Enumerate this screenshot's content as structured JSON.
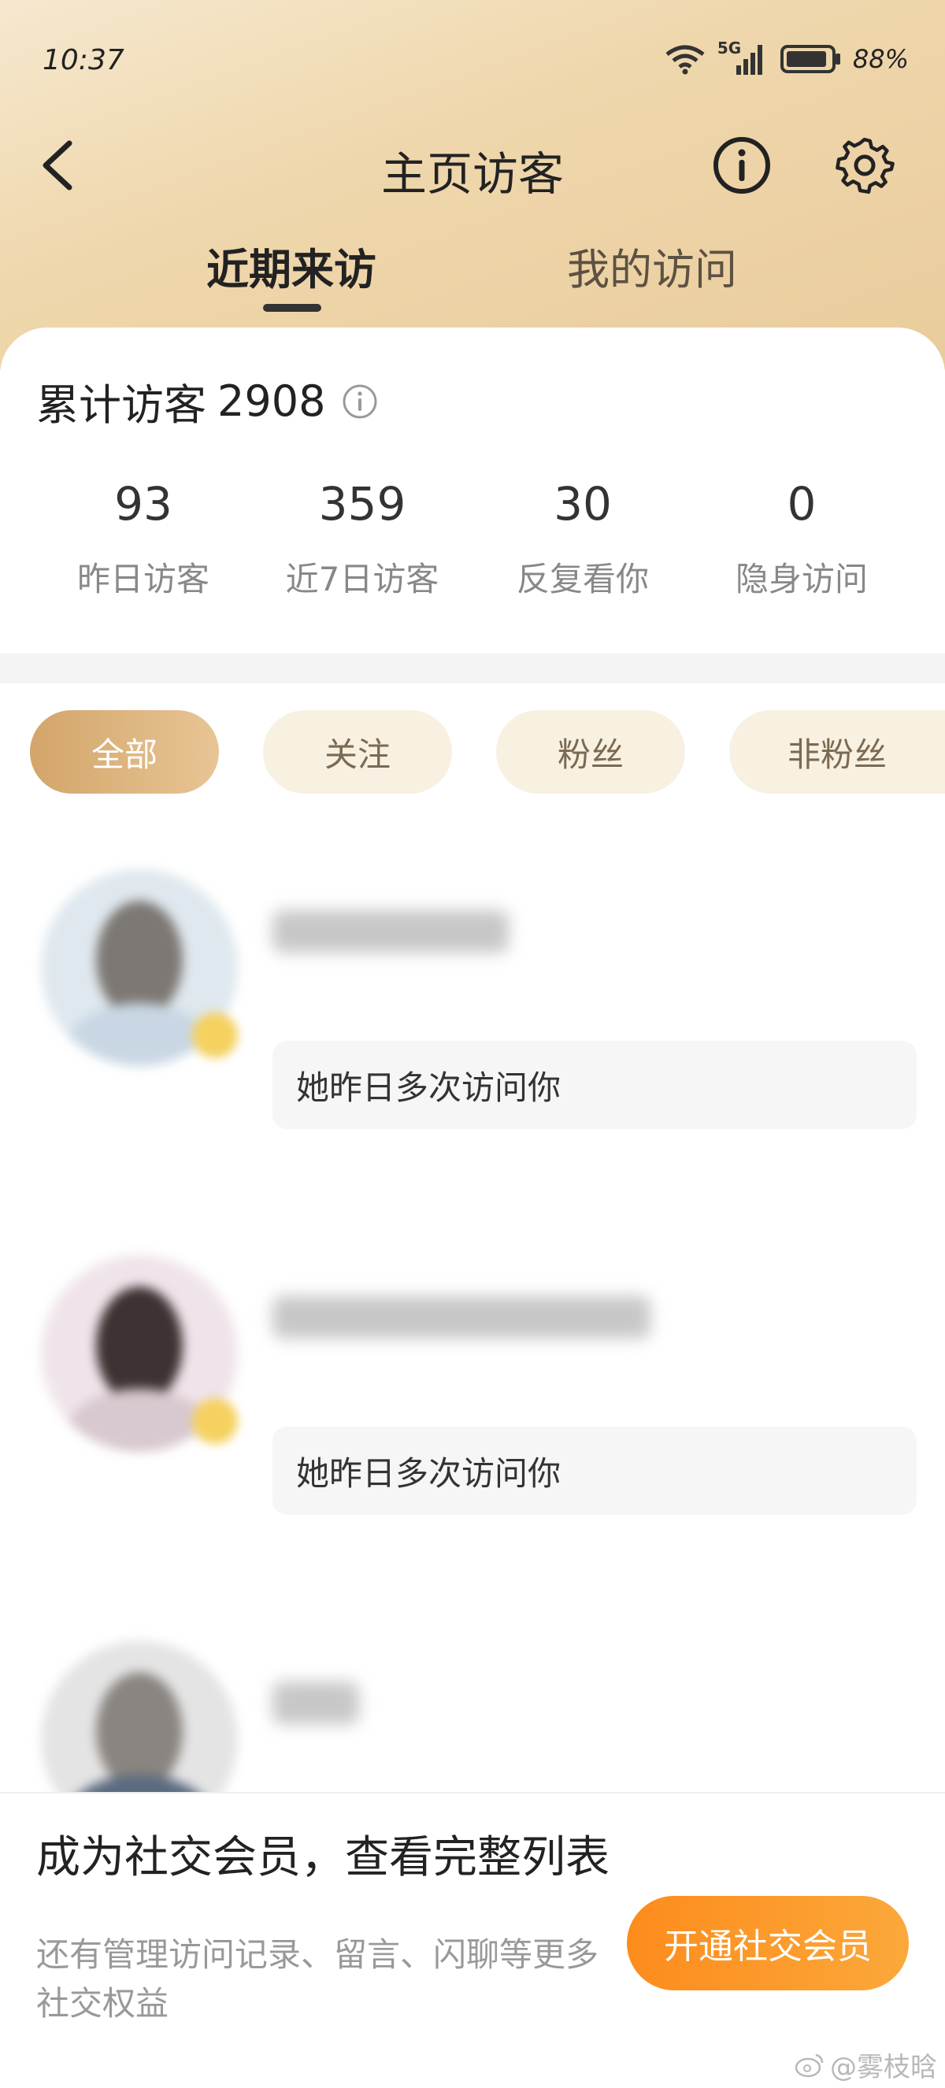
{
  "status_bar": {
    "time": "10:37",
    "network": "5G",
    "battery": "88%"
  },
  "nav": {
    "title": "主页访客"
  },
  "tabs": [
    {
      "label": "近期来访",
      "active": true
    },
    {
      "label": "我的访问",
      "active": false
    }
  ],
  "summary": {
    "total_label": "累计访客",
    "total_value": "2908"
  },
  "stats": [
    {
      "value": "93",
      "label": "昨日访客"
    },
    {
      "value": "359",
      "label": "近7日访客"
    },
    {
      "value": "30",
      "label": "反复看你"
    },
    {
      "value": "0",
      "label": "隐身访问"
    }
  ],
  "filters": [
    {
      "label": "全部",
      "selected": true
    },
    {
      "label": "关注",
      "selected": false
    },
    {
      "label": "粉丝",
      "selected": false
    },
    {
      "label": "非粉丝",
      "selected": false
    }
  ],
  "visitors": [
    {
      "note": "她昨日多次访问你"
    },
    {
      "note": "她昨日多次访问你"
    },
    {
      "note": ""
    }
  ],
  "membership": {
    "title": "成为社交会员，查看完整列表",
    "subtitle": "还有管理访问记录、留言、闪聊等更多社交权益",
    "button": "开通社交会员"
  },
  "watermark": "@雾枝晗",
  "colors": {
    "accent_gold": "#d3a56a",
    "cta_orange": "#fd8c1c"
  }
}
